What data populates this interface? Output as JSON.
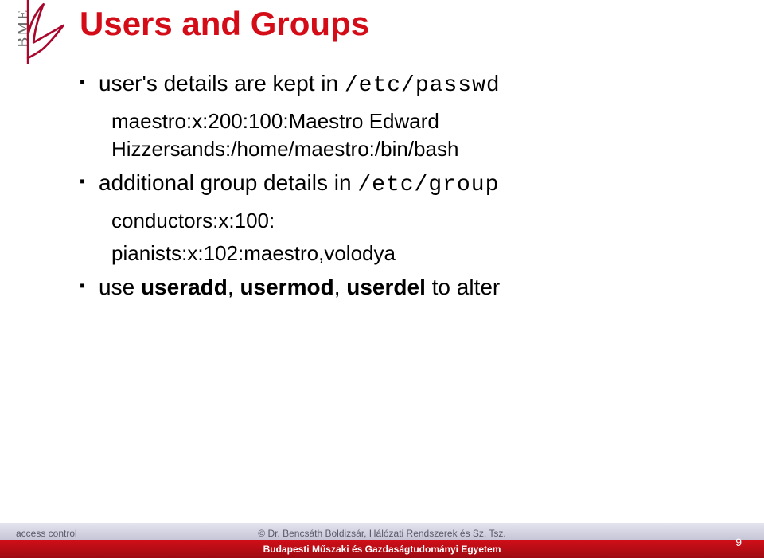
{
  "bme_label": "BME",
  "title": "Users and Groups",
  "bullets": {
    "b1": {
      "pre": "user's details are kept in ",
      "code": "/etc/passwd",
      "sub": "maestro:x:200:100:Maestro Edward Hizzersands:/home/maestro:/bin/bash"
    },
    "b2": {
      "pre": "additional group details in ",
      "code": "/etc/group",
      "sub1": "conductors:x:100:",
      "sub2": "pianists:x:102:maestro,volodya"
    },
    "b3": {
      "w1": "use ",
      "w2": "useradd",
      "w3": ", ",
      "w4": "usermod",
      "w5": ", ",
      "w6": "userdel",
      "w7": " to alter"
    }
  },
  "footer": {
    "left": "access control",
    "author": "©   Dr. Bencsáth Boldizsár, Hálózati Rendszerek és Sz. Tsz.",
    "uni": "Budapesti Műszaki és Gazdaságtudományi Egyetem",
    "page": "9"
  }
}
